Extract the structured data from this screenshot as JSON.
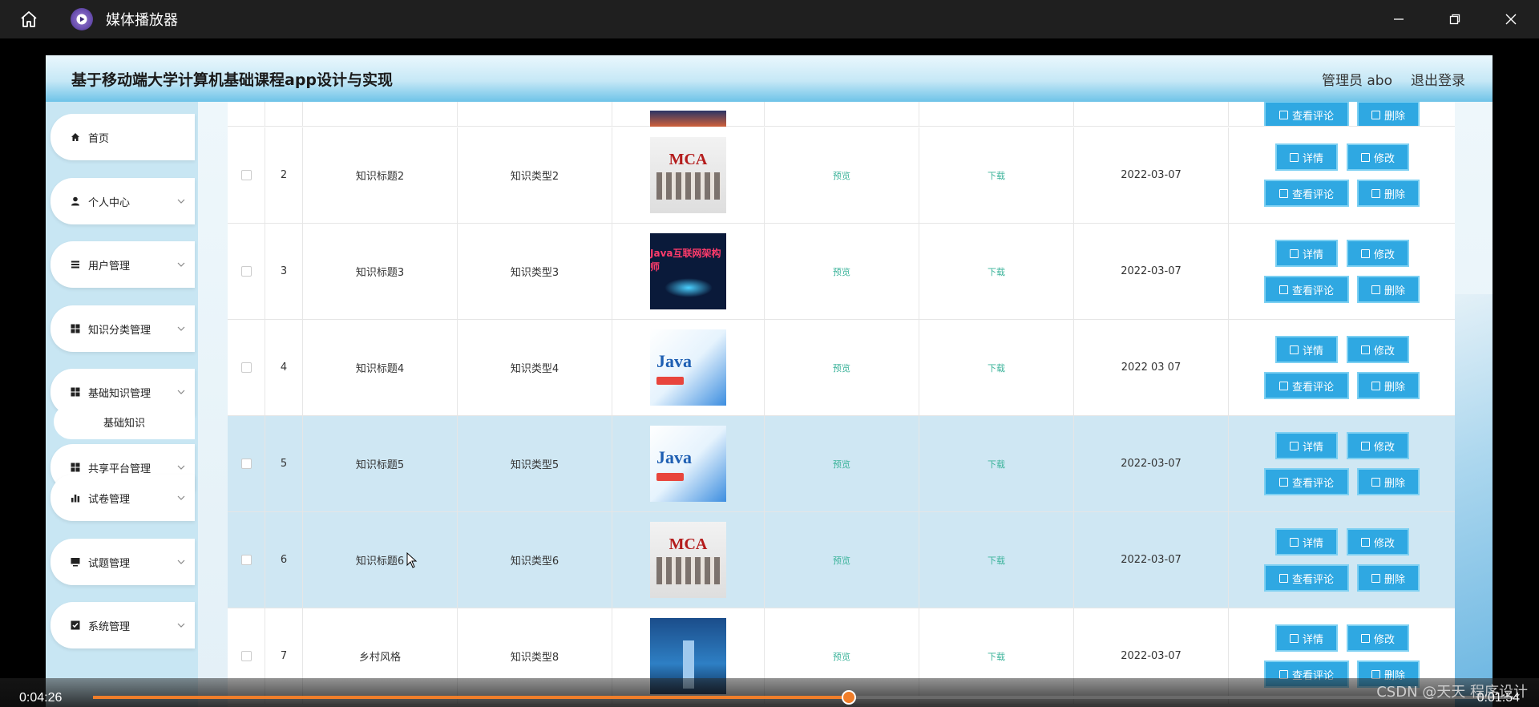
{
  "window": {
    "title": "媒体播放器",
    "controls": [
      "minimize",
      "restore",
      "close"
    ]
  },
  "app": {
    "title": "基于移动端大学计算机基础课程app设计与实现",
    "user_label": "管理员 abo",
    "logout_label": "退出登录"
  },
  "sidebar": {
    "items": [
      {
        "label": "首页",
        "icon": "home-icon",
        "has_children": false
      },
      {
        "label": "个人中心",
        "icon": "user-icon",
        "has_children": true
      },
      {
        "label": "用户管理",
        "icon": "list-icon",
        "has_children": true
      },
      {
        "label": "知识分类管理",
        "icon": "grid-icon",
        "has_children": true
      },
      {
        "label": "基础知识管理",
        "icon": "grid-icon",
        "has_children": true
      },
      {
        "label": "共享平台管理",
        "icon": "grid-icon",
        "has_children": true
      },
      {
        "label": "试卷管理",
        "icon": "bar-chart-icon",
        "has_children": true
      },
      {
        "label": "试题管理",
        "icon": "monitor-icon",
        "has_children": true
      },
      {
        "label": "系统管理",
        "icon": "checkbox-icon",
        "has_children": true
      }
    ],
    "sub_item": "基础知识"
  },
  "table": {
    "preview_label": "预览",
    "download_label": "下载",
    "actions": {
      "detail": "详情",
      "edit": "修改",
      "comment": "查看评论",
      "delete": "删除"
    },
    "rows": [
      {
        "index": "2",
        "title": "知识标题2",
        "type": "知识类型2",
        "date": "2022-03-07",
        "image": "mca",
        "image_text": "MCA",
        "highlight": false
      },
      {
        "index": "3",
        "title": "知识标题3",
        "type": "知识类型3",
        "date": "2022-03-07",
        "image": "jdark",
        "image_text": "Java互联网架构师",
        "highlight": false
      },
      {
        "index": "4",
        "title": "知识标题4",
        "type": "知识类型4",
        "date": "2022 03 07",
        "image": "java",
        "image_text": "Java",
        "highlight": false
      },
      {
        "index": "5",
        "title": "知识标题5",
        "type": "知识类型5",
        "date": "2022-03-07",
        "image": "java",
        "image_text": "Java",
        "highlight": true
      },
      {
        "index": "6",
        "title": "知识标题6",
        "type": "知识类型6",
        "date": "2022-03-07",
        "image": "mca",
        "image_text": "MCA",
        "highlight": true
      },
      {
        "index": "7",
        "title": "乡村风格",
        "type": "知识类型8",
        "date": "2022-03-07",
        "image": "city",
        "image_text": "",
        "highlight": false
      }
    ]
  },
  "player": {
    "current_time": "0:04:26",
    "duration": "0:01:54",
    "progress": 0.532
  },
  "watermark": "CSDN @天天 程序设计",
  "colors": {
    "accent_button": "#2fa8e2",
    "progress": "#f07e2a",
    "link": "#3bb39a",
    "highlight_row": "#cfe7f3"
  }
}
